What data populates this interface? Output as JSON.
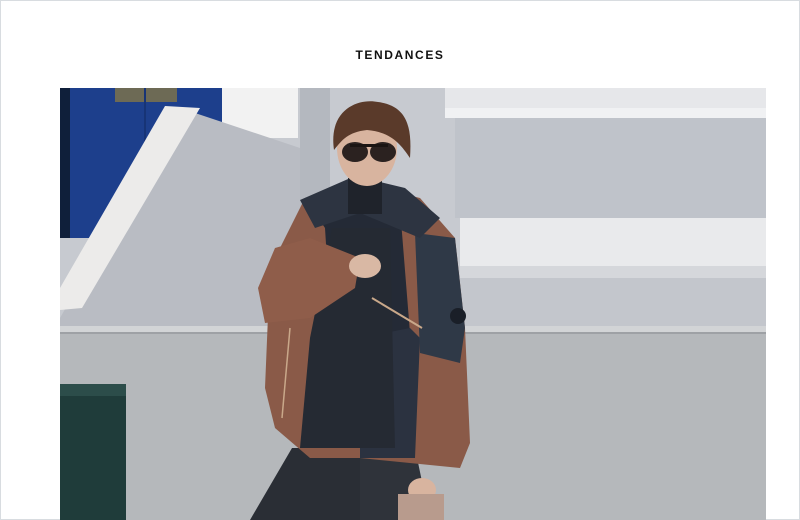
{
  "header": {
    "section_title": "TENDANCES"
  },
  "photo": {
    "subject": "fashion-photo",
    "colors": {
      "door": "#1d3f8c",
      "wall": "#c9ccd2",
      "stucco_light": "#e9eaec",
      "jacket_rust": "#8a5a48",
      "jacket_navy": "#242a36",
      "pavement": "#b7b9bb"
    }
  }
}
